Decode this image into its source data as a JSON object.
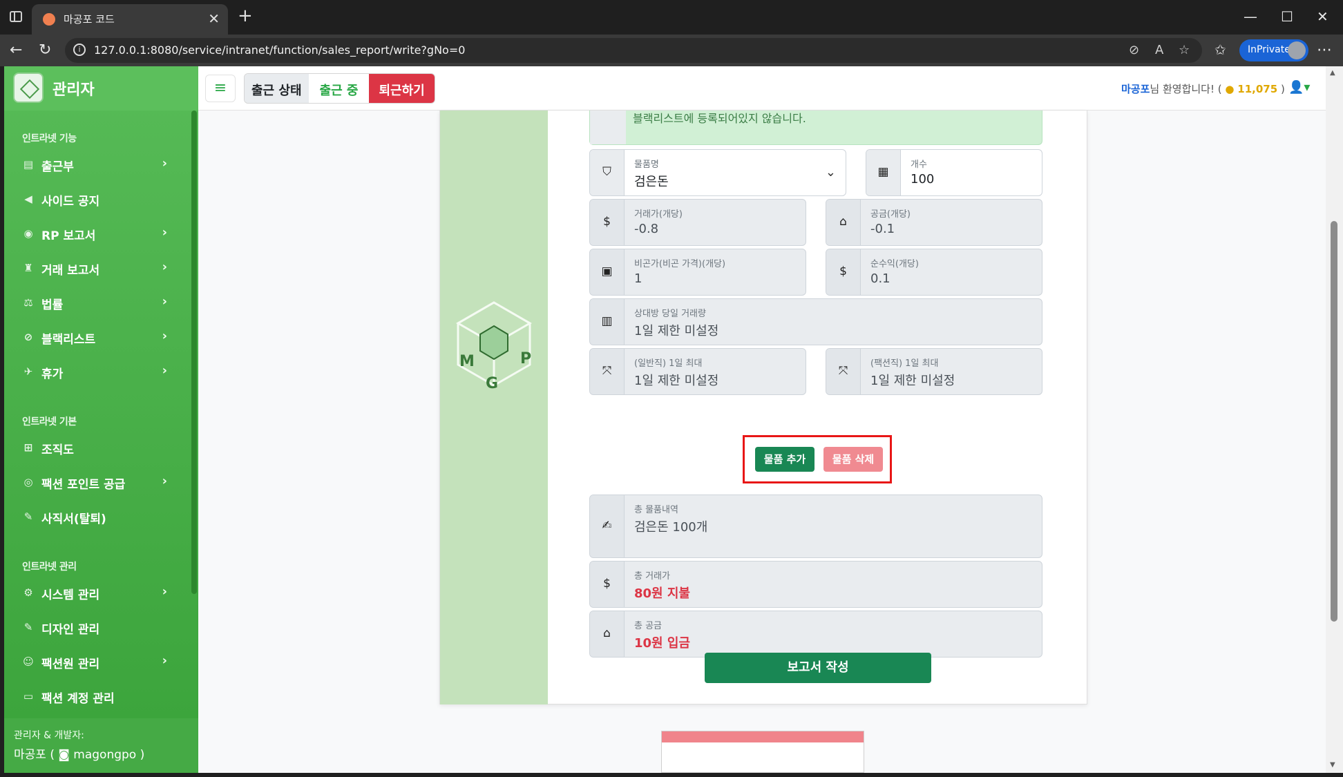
{
  "browser": {
    "tab_title": "마공포 코드",
    "url": "127.0.0.1:8080/service/intranet/function/sales_report/write?gNo=0",
    "inprivate_label": "InPrivate"
  },
  "sidebar": {
    "brand": "관리자",
    "sections": [
      {
        "heading": "인트라넷 기능"
      },
      {
        "heading": "인트라넷 기본"
      },
      {
        "heading": "인트라넷 관리"
      }
    ],
    "items": [
      {
        "label": "출근부",
        "icon": "book-icon",
        "chevron": true
      },
      {
        "label": "사이드 공지",
        "icon": "megaphone-icon",
        "chevron": false
      },
      {
        "label": "RP 보고서",
        "icon": "gamepad-icon",
        "chevron": true
      },
      {
        "label": "거래 보고서",
        "icon": "bag-icon",
        "chevron": true
      },
      {
        "label": "법률",
        "icon": "scale-icon",
        "chevron": true
      },
      {
        "label": "블랙리스트",
        "icon": "ban-icon",
        "chevron": true
      },
      {
        "label": "휴가",
        "icon": "plane-icon",
        "chevron": true
      },
      {
        "label": "조직도",
        "icon": "sitemap-icon",
        "chevron": false
      },
      {
        "label": "팩션 포인트 공급",
        "icon": "coins-icon",
        "chevron": true
      },
      {
        "label": "사직서(탈퇴)",
        "icon": "pen-icon",
        "chevron": false
      },
      {
        "label": "시스템 관리",
        "icon": "gear-icon",
        "chevron": true
      },
      {
        "label": "디자인 관리",
        "icon": "brush-icon",
        "chevron": false
      },
      {
        "label": "팩션원 관리",
        "icon": "users-gear-icon",
        "chevron": true
      },
      {
        "label": "팩션 계정 관리",
        "icon": "id-card-icon",
        "chevron": false
      }
    ],
    "footer_title": "관리자 & 개발자:",
    "footer_name": "마공포 ( ",
    "footer_discord": "magongpo )"
  },
  "topbar": {
    "attendance_status": "출근 상태",
    "attendance_on": "출근 중",
    "leave_button": "퇴근하기",
    "welcome_name": "마공포",
    "welcome_text": "님 환영합니다! (",
    "points": "11,075",
    "points_close": ")"
  },
  "form": {
    "alert_text": "블랙리스트에 등록되어있지 않습니다.",
    "fields": {
      "item_name": {
        "label": "물품명",
        "value": "검은돈"
      },
      "count": {
        "label": "개수",
        "value": "100"
      },
      "trade_price": {
        "label": "거래가(개당)",
        "value": "-0.8"
      },
      "supply": {
        "label": "공금(개당)",
        "value": "-0.1"
      },
      "secret_price": {
        "label": "비곤가(비곤 가격)(개당)",
        "value": "1"
      },
      "net_profit": {
        "label": "순수익(개당)",
        "value": "0.1"
      },
      "partner_daily": {
        "label": "상대방 당일 거래량",
        "value": "1일 제한 미설정"
      },
      "general_daily_max": {
        "label": "(일반직) 1일 최대",
        "value": "1일 제한 미설정"
      },
      "faction_daily_max": {
        "label": "(팩션직) 1일 최대",
        "value": "1일 제한 미설정"
      },
      "total_items": {
        "label": "총 물품내역",
        "value": "검은돈 100개"
      },
      "total_trade": {
        "label": "총 거래가",
        "value": "80원 지불"
      },
      "total_supply": {
        "label": "총 공금",
        "value": "10원 입금"
      }
    },
    "add_item_button": "물품 추가",
    "delete_item_button": "물품 삭제",
    "submit_button": "보고서 작성"
  },
  "colors": {
    "sidebar_green": "#4caf50",
    "primary_green": "#198754",
    "danger_red": "#dc3545",
    "highlight_red": "#e81616"
  }
}
